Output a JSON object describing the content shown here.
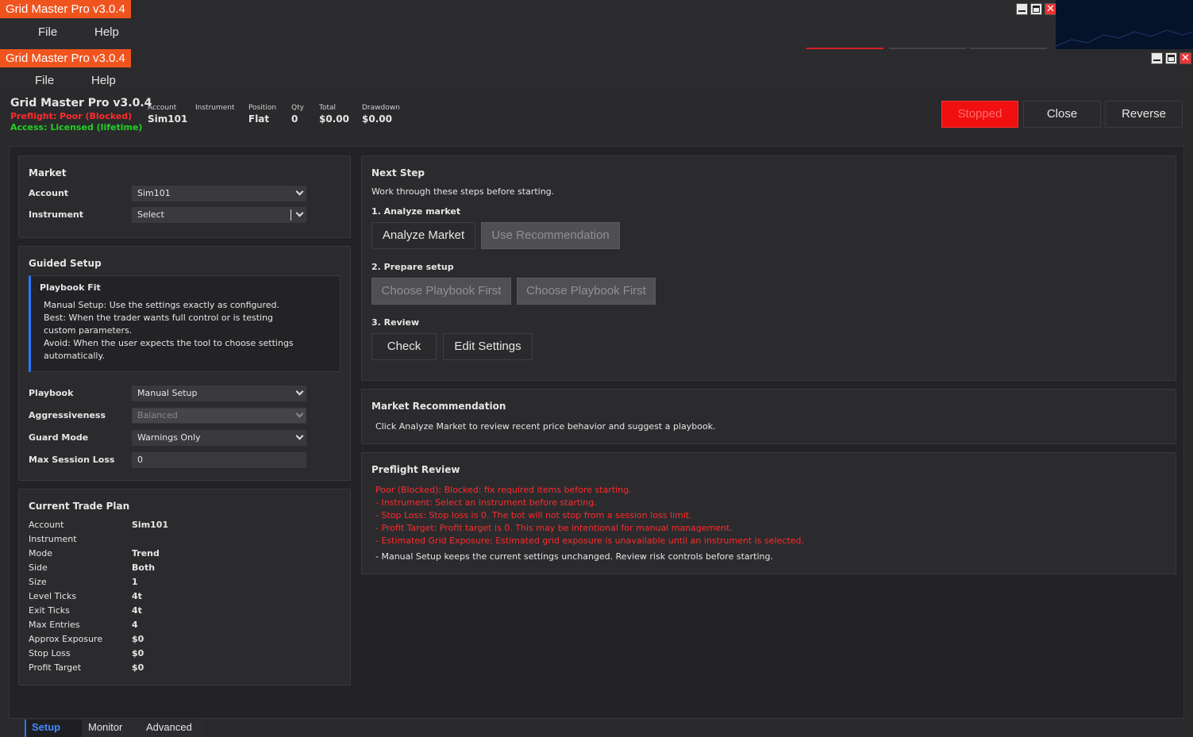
{
  "background_window": {
    "title": "Grid Master Pro v3.0.4",
    "menu": [
      "File",
      "Help"
    ]
  },
  "window": {
    "title": "Grid Master Pro v3.0.4",
    "menu": {
      "file": "File",
      "help": "Help"
    },
    "controls": {
      "minimize_icon": "minimize-icon",
      "maximize_icon": "maximize-icon",
      "close_icon": "close-icon"
    }
  },
  "header": {
    "app_title": "Grid Master Pro v3.0.4",
    "preflight": "Preflight: Poor (Blocked)",
    "access": "Access: Licensed (lifetime)",
    "stats": [
      {
        "label": "Account",
        "value": "Sim101"
      },
      {
        "label": "Instrument",
        "value": ""
      },
      {
        "label": "Position",
        "value": "Flat"
      },
      {
        "label": "Qty",
        "value": "0"
      },
      {
        "label": "Total",
        "value": "$0.00"
      },
      {
        "label": "Drawdown",
        "value": "$0.00"
      }
    ],
    "buttons": {
      "stopped": "Stopped",
      "close": "Close",
      "reverse": "Reverse"
    },
    "colors": {
      "stopped_bg": "#f01010",
      "preflight": "#ff2a2a",
      "access": "#22d122"
    }
  },
  "market": {
    "title": "Market",
    "account_label": "Account",
    "account_value": "Sim101",
    "instrument_label": "Instrument",
    "instrument_value": "Select"
  },
  "guided": {
    "title": "Guided Setup",
    "fit_title": "Playbook Fit",
    "fit_lines": [
      "Manual Setup: Use the settings exactly as configured.",
      "Best: When the trader wants full control or is testing custom parameters.",
      "Avoid: When the user expects the tool to choose settings automatically."
    ],
    "playbook_label": "Playbook",
    "playbook_value": "Manual Setup",
    "aggr_label": "Aggressiveness",
    "aggr_value": "Balanced",
    "guard_label": "Guard Mode",
    "guard_value": "Warnings Only",
    "maxloss_label": "Max Session Loss",
    "maxloss_value": "0"
  },
  "plan": {
    "title": "Current Trade Plan",
    "rows": [
      {
        "label": "Account",
        "value": "Sim101"
      },
      {
        "label": "Instrument",
        "value": ""
      },
      {
        "label": "Mode",
        "value": "Trend"
      },
      {
        "label": "Side",
        "value": "Both"
      },
      {
        "label": "Size",
        "value": "1"
      },
      {
        "label": "Level Ticks",
        "value": "4t"
      },
      {
        "label": "Exit Ticks",
        "value": "4t"
      },
      {
        "label": "Max Entries",
        "value": "4"
      },
      {
        "label": "Approx Exposure",
        "value": "$0"
      },
      {
        "label": "Stop Loss",
        "value": "$0"
      },
      {
        "label": "Profit Target",
        "value": "$0"
      }
    ]
  },
  "next": {
    "title": "Next Step",
    "intro": "Work through these steps before starting.",
    "step1": "1. Analyze market",
    "analyze_btn": "Analyze Market",
    "use_rec_btn": "Use Recommendation",
    "step2": "2. Prepare setup",
    "choose1_btn": "Choose Playbook First",
    "choose2_btn": "Choose Playbook First",
    "step3": "3. Review",
    "check_btn": "Check",
    "edit_btn": "Edit Settings"
  },
  "recommendation": {
    "title": "Market Recommendation",
    "text": "Click Analyze Market to review recent price behavior and suggest a playbook."
  },
  "preflight": {
    "title": "Preflight Review",
    "errors": [
      "Poor (Blocked): Blocked: fix required items before starting.",
      "- Instrument: Select an instrument before starting.",
      "- Stop Loss: Stop loss is 0. The bot will not stop from a session loss limit.",
      "- Profit Target: Profit target is 0. This may be intentional for manual management.",
      "- Estimated Grid Exposure: Estimated grid exposure is unavailable until an instrument is selected."
    ],
    "note": "- Manual Setup keeps the current settings unchanged. Review risk controls before starting.",
    "error_color": "#ff2a2a"
  },
  "tabs": {
    "setup": "Setup",
    "monitor": "Monitor",
    "advanced": "Advanced"
  }
}
